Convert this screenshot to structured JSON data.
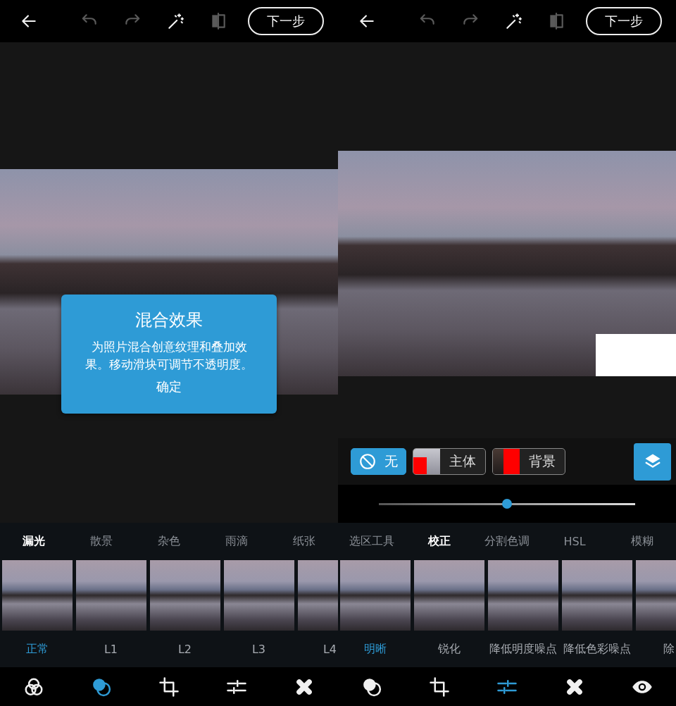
{
  "left_screen": {
    "top_bar": {
      "tools": [
        {
          "kind": "back",
          "disabled": false
        },
        {
          "kind": "undo",
          "disabled": true
        },
        {
          "kind": "redo",
          "disabled": true
        },
        {
          "kind": "wand",
          "disabled": false
        },
        {
          "kind": "compare",
          "disabled": true
        }
      ],
      "next_button": "下一步"
    },
    "dialog": {
      "title": "混合效果",
      "body": "为照片混合创意纹理和叠加效果。移动滑块可调节不透明度。",
      "confirm": "确定"
    },
    "categories": [
      {
        "label": "漏光",
        "selected": true
      },
      {
        "label": "散景",
        "selected": false
      },
      {
        "label": "杂色",
        "selected": false
      },
      {
        "label": "雨滴",
        "selected": false
      },
      {
        "label": "纸张",
        "selected": false
      }
    ],
    "effects": [
      {
        "label": "正常",
        "selected": true
      },
      {
        "label": "L1",
        "selected": false
      },
      {
        "label": "L2",
        "selected": false
      },
      {
        "label": "L3",
        "selected": false
      },
      {
        "label": "L4",
        "selected": false
      }
    ],
    "nav": [
      {
        "kind": "venn",
        "selected": false
      },
      {
        "kind": "blend",
        "selected": true
      },
      {
        "kind": "crop",
        "selected": false
      },
      {
        "kind": "adjust",
        "selected": false
      },
      {
        "kind": "heal",
        "selected": false
      }
    ]
  },
  "right_screen": {
    "top_bar": {
      "tools": [
        {
          "kind": "back",
          "disabled": false
        },
        {
          "kind": "undo",
          "disabled": true
        },
        {
          "kind": "redo",
          "disabled": true
        },
        {
          "kind": "wand",
          "disabled": false
        },
        {
          "kind": "compare",
          "disabled": true
        }
      ],
      "next_button": "下一步"
    },
    "selection_chips": [
      {
        "kind": "none",
        "label": "无",
        "selected": true
      },
      {
        "kind": "subject",
        "label": "主体",
        "selected": false
      },
      {
        "kind": "background",
        "label": "背景",
        "selected": false
      }
    ],
    "slider": {
      "level": 0.5
    },
    "categories": [
      {
        "label": "选区工具",
        "selected": false
      },
      {
        "label": "校正",
        "selected": true
      },
      {
        "label": "分割色调",
        "selected": false
      },
      {
        "label": "HSL",
        "selected": false
      },
      {
        "label": "模糊",
        "selected": false
      }
    ],
    "effects": [
      {
        "label": "明晰",
        "selected": true
      },
      {
        "label": "锐化",
        "selected": false
      },
      {
        "label": "降低明度噪点",
        "selected": false
      },
      {
        "label": "降低色彩噪点",
        "selected": false
      },
      {
        "label": "除",
        "selected": false
      }
    ],
    "nav": [
      {
        "kind": "blend",
        "selected": false
      },
      {
        "kind": "crop",
        "selected": false
      },
      {
        "kind": "adjust",
        "selected": true
      },
      {
        "kind": "heal",
        "selected": false
      },
      {
        "kind": "eye",
        "selected": false
      }
    ]
  }
}
